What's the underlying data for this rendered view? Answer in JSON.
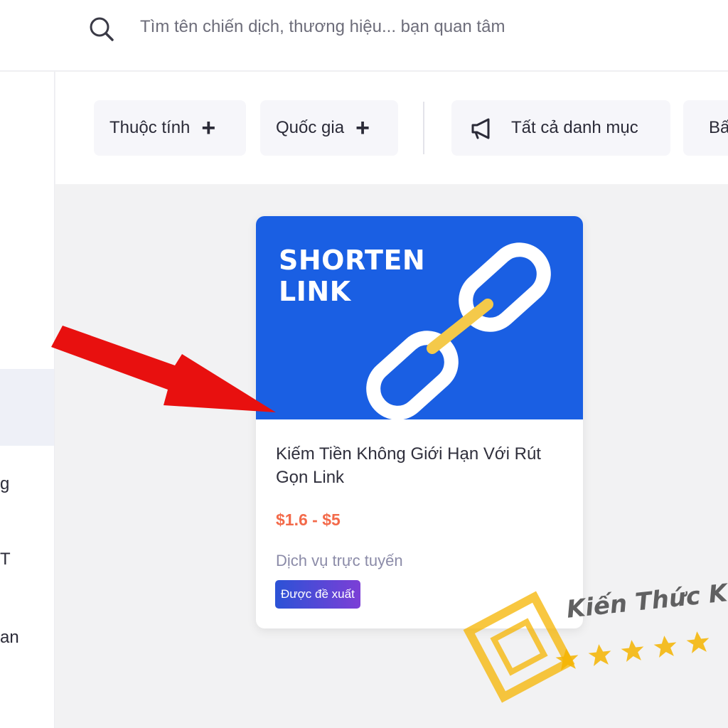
{
  "search": {
    "placeholder": "Tìm tên chiến dịch, thương hiệu... bạn quan tâm",
    "icon": "search-icon"
  },
  "filters": {
    "attribute": {
      "label": "Thuộc tính",
      "icon": "plus-icon"
    },
    "country": {
      "label": "Quốc gia",
      "icon": "plus-icon"
    },
    "category": {
      "label": "Tất cả danh mục",
      "icon": "megaphone-icon"
    },
    "partial": {
      "label": "Bấ"
    }
  },
  "sidebar": {
    "fragments": [
      "g",
      "T",
      "an"
    ]
  },
  "campaign": {
    "banner_line1": "SHORTEN",
    "banner_line2": "LINK",
    "title": "Kiếm Tiền Không Giới Hạn Với Rút Gọn Link",
    "price": "$1.6 - $5",
    "category": "Dịch vụ trực tuyến",
    "badge": "Được đề xuất"
  },
  "watermark": {
    "text": "Kiến Thức Ki",
    "stars": 5
  },
  "colors": {
    "banner": "#1a5fe3",
    "price": "#f36a4a",
    "badge_start": "#2b52d6",
    "badge_end": "#7c3fd6",
    "arrow": "#e8100f",
    "watermark_gold": "#f5b400"
  }
}
